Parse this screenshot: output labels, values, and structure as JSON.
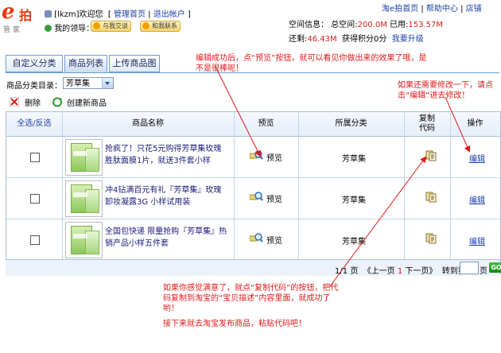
{
  "header": {
    "logo_e": "e",
    "logo_pai": "拍",
    "logo_sub": "管家",
    "user_line": "[lkzm]欢迎您",
    "nav_links": [
      "管理首页",
      "退出帐户"
    ],
    "leader_label": "我的领导：",
    "leader_btn1": "与我交谈",
    "leader_btn2": "和我联系",
    "top_links": [
      "淘e拍首页",
      "帮助中心",
      "店铺"
    ],
    "space_label": "空间信息：",
    "total_label": "总空间",
    "total_value": "200.0M",
    "used_label": "已用",
    "used_value": "153.57M",
    "remaining_label": "还剩",
    "remaining_value": "46.43M",
    "points_text": "获得积分0分",
    "upgrade": "我要升级"
  },
  "tabs": [
    {
      "label": "自定义分类",
      "active": false
    },
    {
      "label": "商品列表",
      "active": true
    },
    {
      "label": "上传商品图",
      "active": false
    }
  ],
  "category_filter": {
    "label": "商品分类目录：",
    "selected": "芳草集"
  },
  "actions": {
    "delete": "删除",
    "create": "创建新商品"
  },
  "table": {
    "headers": {
      "select_all": "全选/反选",
      "name": "商品名称",
      "preview": "预览",
      "category": "所属分类",
      "copy_line1": "复制",
      "copy_line2": "代码",
      "operation": "操作"
    },
    "rows": [
      {
        "name": "抢疯了！只花5元购得芳草集玫瑰胜肽面膜1片，就送3件套小样",
        "preview": "预览",
        "category": "芳草集",
        "edit": "编辑"
      },
      {
        "name": "冲4钻满百元有礼『芳草集』玫瑰卸妆凝露3G 小样试用装",
        "preview": "预览",
        "category": "芳草集",
        "edit": "编辑"
      },
      {
        "name": "全国包快递 限量抢购『芳草集』热销产品小样五件套",
        "preview": "预览",
        "category": "芳草集",
        "edit": "编辑"
      }
    ]
  },
  "pager": {
    "current": "1",
    "sep": "/",
    "total": "1",
    "page_unit": "页",
    "prev_label": "《上一页",
    "page_num": "1",
    "next_label": "下一页》",
    "goto_label": "转到第",
    "goto_unit": "页",
    "go": "GO"
  },
  "annotations": {
    "top": "编辑成功后，点“预览”按钮，就可以看见你做出来的效果了哦，是不是很棒呢！",
    "right": "如果还需要修改一下，请点击“编辑”进去修改！",
    "bottom1": "如果你感觉满意了，就点“复制代码”的按钮，把代码复制到淘宝的“宝贝描述”内容里面，就成功了哟！",
    "bottom2": "接下来就去淘宝发布商品，粘贴代码吧！"
  },
  "colors": {
    "annotation": "#e01818",
    "link": "#1b3fa5",
    "accent": "#e8380d"
  }
}
